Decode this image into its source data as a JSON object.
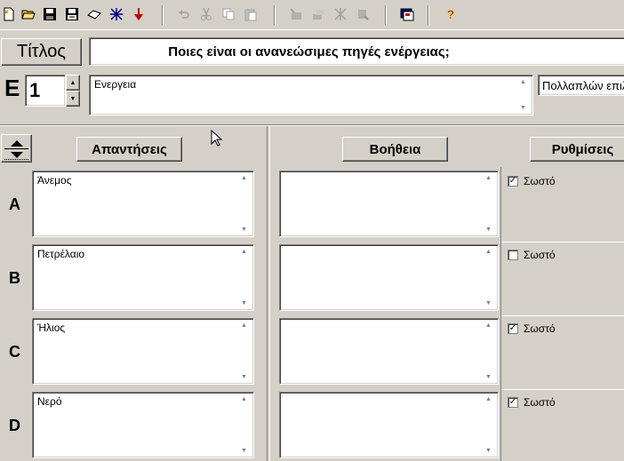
{
  "toolbar": {
    "icons": [
      "new-icon",
      "open-icon",
      "save-icon",
      "save-as-icon",
      "erase-icon",
      "insert-arrow-icon",
      "undo-icon",
      "cut-icon",
      "copy-icon",
      "paste-icon",
      "tool-a-icon",
      "tool-b-icon",
      "tool-c-icon",
      "tool-d-icon",
      "preview-icon",
      "help-icon"
    ]
  },
  "title_button": "Τίτλος",
  "question_title": "Ποιες είναι οι ανανεώσιμες πηγές ενέργειας;",
  "question_prefix": "E",
  "question_number": "1",
  "subject_text": "Ενεργεια",
  "question_type": "Πολλαπλών επιλ",
  "headers": {
    "answers": "Απαντήσεις",
    "help": "Βοήθεια",
    "settings": "Ρυθμίσεις"
  },
  "answers": [
    {
      "letter": "A",
      "text": "Άνεμος",
      "help": "",
      "correct_label": "Σωστό",
      "correct": true
    },
    {
      "letter": "B",
      "text": "Πετρέλαιο",
      "help": "",
      "correct_label": "Σωστό",
      "correct": false
    },
    {
      "letter": "C",
      "text": "Ήλιος",
      "help": "",
      "correct_label": "Σωστό",
      "correct": true
    },
    {
      "letter": "D",
      "text": "Νερό",
      "help": "",
      "correct_label": "Σωστό",
      "correct": true
    }
  ]
}
